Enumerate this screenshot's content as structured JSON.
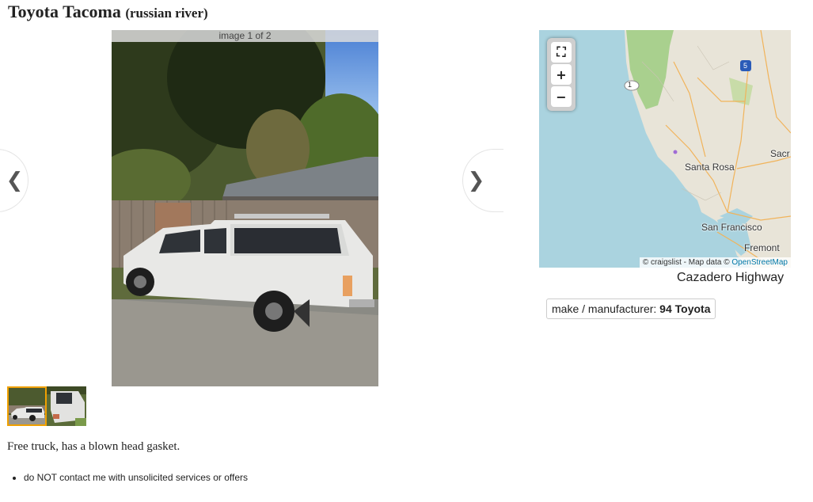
{
  "posting": {
    "title": "Toyota Tacoma",
    "location": "(russian river)"
  },
  "gallery": {
    "counter": "image 1 of 2",
    "prev_icon": "chevron-left-icon",
    "next_icon": "chevron-right-icon",
    "prev_glyph": "❮",
    "next_glyph": "❯"
  },
  "map": {
    "fullscreen_glyph": "⛶",
    "zoom_in": "+",
    "zoom_out": "−",
    "labels": {
      "santa_rosa": "Santa Rosa",
      "san_francisco": "San Francisco",
      "fremont": "Fremont",
      "sacramento": "Sacr",
      "route_1": "1",
      "route_5": "5"
    },
    "attribution": {
      "prefix": "© craigslist - Map data ©",
      "link": "OpenStreetMap"
    },
    "address": "Cazadero Highway"
  },
  "attributes": {
    "label": "make / manufacturer:",
    "value": "94 Toyota"
  },
  "description": "Free truck, has a blown head gasket.",
  "notices": [
    "do NOT contact me with unsolicited services or offers"
  ]
}
